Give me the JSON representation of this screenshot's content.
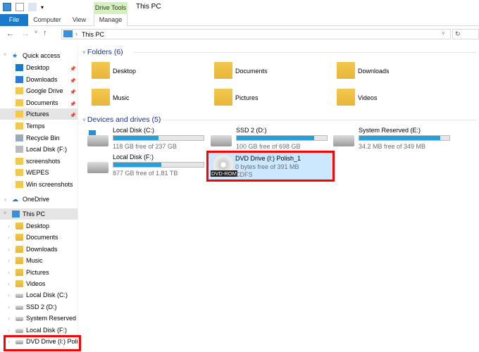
{
  "window": {
    "title": "This PC"
  },
  "ribbon": {
    "tabs": [
      "File",
      "Computer",
      "View",
      "Manage"
    ],
    "context_group": "Drive Tools"
  },
  "address": {
    "path": "This PC"
  },
  "sidebar": {
    "quick_access": "Quick access",
    "quick_items": [
      "Desktop",
      "Downloads",
      "Google Drive",
      "Documents",
      "Pictures",
      "Temps",
      "Recycle Bin",
      "Local Disk (F:)",
      "screenshots",
      "WEPES",
      "Win screenshots"
    ],
    "onedrive": "OneDrive",
    "this_pc": "This PC",
    "pc_items": [
      "Desktop",
      "Documents",
      "Downloads",
      "Music",
      "Pictures",
      "Videos",
      "Local Disk (C:)",
      "SSD 2 (D:)",
      "System Reserved (E:",
      "Local Disk (F:)",
      "DVD Drive (I:) Polish"
    ]
  },
  "folders": {
    "header": "Folders (6)",
    "items": [
      "Desktop",
      "Documents",
      "Downloads",
      "Music",
      "Pictures",
      "Videos"
    ]
  },
  "drives": {
    "header": "Devices and drives (5)",
    "items": [
      {
        "name": "Local Disk (C:)",
        "free": "118 GB free of 237 GB",
        "used": 0.5
      },
      {
        "name": "SSD 2 (D:)",
        "free": "100 GB free of 698 GB",
        "used": 0.86
      },
      {
        "name": "System Reserved (E:)",
        "free": "34.2 MB free of 349 MB",
        "used": 0.9
      },
      {
        "name": "Local Disk (F:)",
        "free": "877 GB free of 1.81 TB",
        "used": 0.53
      },
      {
        "name": "DVD Drive (I:) Polish_1",
        "free": "0 bytes free of 391 MB",
        "fs": "CDFS",
        "badge": "DVD-ROM"
      }
    ]
  },
  "colors": {
    "accent": "#1979ca",
    "bar": "#26a0da",
    "highlight": "#ff0000",
    "selection": "#cce8ff"
  }
}
